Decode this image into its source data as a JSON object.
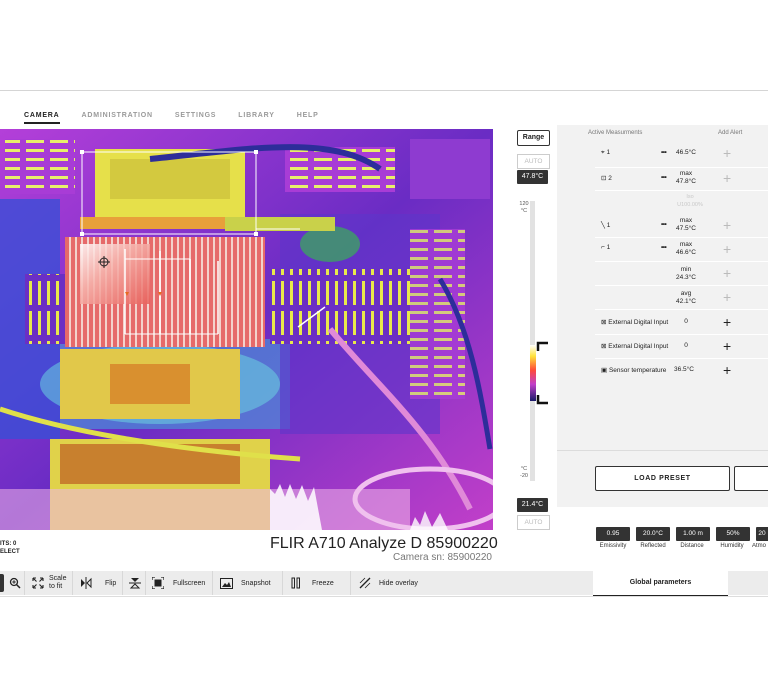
{
  "nav": {
    "tabs": [
      "CAMERA",
      "ADMINISTRATION",
      "SETTINGS",
      "LIBRARY",
      "HELP"
    ],
    "active": 0
  },
  "scale": {
    "range_label": "Range",
    "auto_top": "AUTO",
    "max_temp": "47.8°C",
    "top_value": "120",
    "top_unit": "°C",
    "bottom_unit": "°C",
    "bottom_value": "-20",
    "min_temp": "21.4°C",
    "auto_bottom": "AUTO"
  },
  "panel": {
    "header_measurements": "Active Measurments",
    "header_alert": "Add Alert",
    "rows": [
      {
        "name": "1",
        "value": "46.5°C"
      },
      {
        "name": "2",
        "label": "max",
        "value": "47.8°C"
      },
      {
        "name": "1",
        "label": "max",
        "value": "47.5°C"
      },
      {
        "name": "1",
        "label": "max",
        "value": "46.6°C"
      },
      {
        "name": "",
        "label": "min",
        "value": "24.3°C"
      },
      {
        "name": "",
        "label": "avg",
        "value": "42.1°C"
      },
      {
        "name": "External Digital Input",
        "value": "0"
      },
      {
        "name": "External Digital Input",
        "value": "0"
      },
      {
        "name": "Sensor temperature",
        "value": "36.5°C"
      }
    ],
    "faded_note": [
      "Iso",
      "U100.00%"
    ],
    "load_preset": "LOAD PRESET"
  },
  "params": [
    {
      "value": "0.95",
      "label": "Emissivity"
    },
    {
      "value": "20.0°C",
      "label": "Reflected"
    },
    {
      "value": "1.00 m",
      "label": "Distance"
    },
    {
      "value": "50%",
      "label": "Humidity"
    },
    {
      "value": "20",
      "label": "Atmo"
    }
  ],
  "camera": {
    "title": "FLIR A710 Analyze D 85900220",
    "sn": "Camera sn: 85900220"
  },
  "side_meta": [
    "ITS: 0",
    "ELECT"
  ],
  "toolbar": {
    "scale": "Scale to fit",
    "flip": "Flip",
    "fullscreen": "Fullscreen",
    "snapshot": "Snapshot",
    "freeze": "Freeze",
    "hide_overlay": "Hide overlay",
    "global": "Global parameters"
  },
  "colors": {
    "dark": "#333333",
    "panel": "#f2f2f2",
    "thermal_bg": "#7a2fbf",
    "hot": "#ffe23a"
  }
}
